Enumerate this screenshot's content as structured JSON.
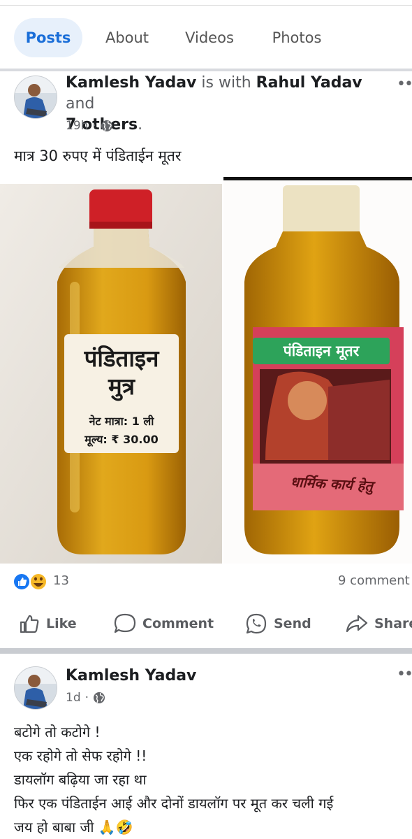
{
  "tabs": [
    {
      "label": "Posts",
      "active": true
    },
    {
      "label": "About",
      "active": false
    },
    {
      "label": "Videos",
      "active": false
    },
    {
      "label": "Photos",
      "active": false
    }
  ],
  "post1": {
    "author": "Kamlesh Yadav",
    "with_text": "is with",
    "tagged": "Rahul Yadav",
    "and_text": "and",
    "others": "7 others",
    "time": "19h",
    "text": "मात्र 30 रुपए में पंडिताईन मूतर",
    "image_left": {
      "label_title_line1": "पंडिताइन",
      "label_title_line2": "मुत्र",
      "label_qty": "नेट मात्रा:  1 ली",
      "label_price": "मूल्य: ₹ 30.00"
    },
    "image_right": {
      "label_top": "पंडिताइन मूतर",
      "label_bottom": "धार्मिक कार्य हेतु"
    },
    "reaction_count": "13",
    "comment_count": "9 comment",
    "actions": {
      "like": "Like",
      "comment": "Comment",
      "send": "Send",
      "share": "Share"
    }
  },
  "post2": {
    "author": "Kamlesh Yadav",
    "time": "1d",
    "lines": [
      "बटोगे तो कटोगे !",
      "एक रहोगे तो सेफ रहोगे !!",
      "डायलॉग बढ़िया जा रहा था",
      "फिर एक पंडिताईन आई और दोनों डायलॉग पर मूत कर चली गई",
      "जय हो बाबा जी 🙏🤣"
    ]
  },
  "colors": {
    "accent": "#1a6ed8",
    "like_blue": "#1877f2",
    "haha_yellow": "#f7b928"
  }
}
